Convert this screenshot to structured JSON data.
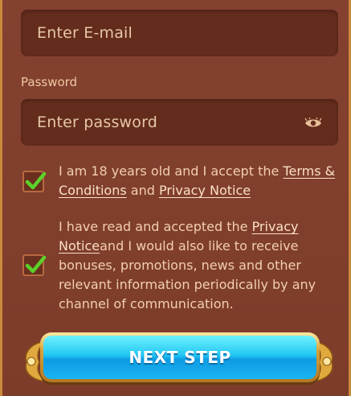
{
  "email": {
    "placeholder": "Enter E-mail"
  },
  "password": {
    "label": "Password",
    "placeholder": "Enter password",
    "toggle_icon": "eye-icon"
  },
  "consents": [
    {
      "checked": true,
      "text_before": "I am 18 years old and I accept the ",
      "link1": "Terms & Conditions",
      "text_middle": " and ",
      "link2": "Privacy Notice"
    },
    {
      "checked": true,
      "text_before": "I have read and accepted the ",
      "link1": "Privacy Notice",
      "text_after": "and I would also like to receive bonuses, promotions, news and other relevant information periodically by any channel of communication."
    }
  ],
  "next_button": {
    "label": "NEXT STEP"
  },
  "colors": {
    "panel_bg": "#844130",
    "input_bg": "#642c1c",
    "text": "#f2cfae",
    "check_green": "#5bd12a",
    "button_blue": "#22c7f2",
    "button_gold": "#d9a43a"
  }
}
